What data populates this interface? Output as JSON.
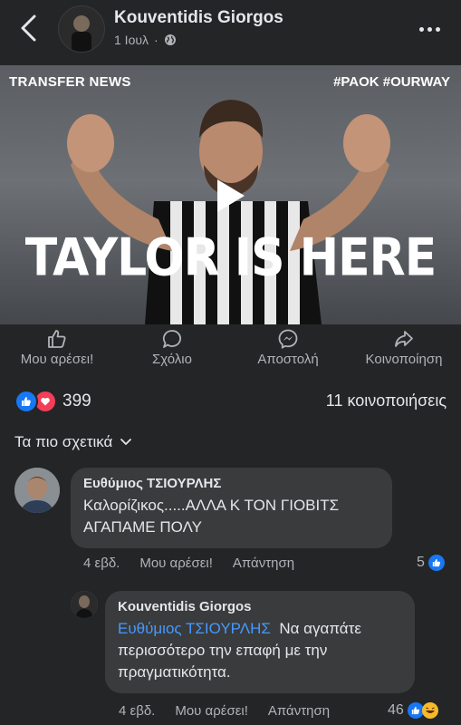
{
  "header": {
    "author_name": "Kouventidis Giorgos",
    "post_date": "1 Ιουλ"
  },
  "media": {
    "tag_left": "TRANSFER NEWS",
    "tag_right": "#PAOK #OURWAY",
    "headline": "TAYLOR IS HERE"
  },
  "actions": {
    "like": "Μου αρέσει!",
    "comment": "Σχόλιο",
    "send": "Αποστολή",
    "share": "Κοινοποίηση"
  },
  "stats": {
    "reaction_count": "399",
    "shares": "11 κοινοποιήσεις"
  },
  "sort": {
    "label": "Τα πιο σχετικά"
  },
  "comments": [
    {
      "author": "Ευθύμιος ΤΣΙΟΥΡΛΗΣ",
      "text_line1": "Καλορίζικος.....ΑΛΛΑ Κ ΤΟΝ ΓΙΟΒΙΤΣ",
      "text_line2": "ΑΓΑΠΑΜΕ ΠΟΛΥ",
      "time": "4 εβδ.",
      "like": "Μου αρέσει!",
      "reply": "Απάντηση",
      "reaction_count": "5"
    },
    {
      "author": "Kouventidis Giorgos",
      "mention": "Ευθύμιος ΤΣΙΟΥΡΛΗΣ",
      "text_line1_rest": "Να αγαπάτε",
      "text_line2": "περισσότερο την επαφή με την",
      "text_line3": "πραγματικότητα.",
      "time": "4 εβδ.",
      "like": "Μου αρέσει!",
      "reply": "Απάντηση",
      "reaction_count": "46"
    }
  ],
  "colors": {
    "background": "#242526",
    "bubble": "#3a3b3c",
    "accent_blue": "#1877f2",
    "mention_blue": "#4599ff",
    "love_red": "#f33e58"
  }
}
